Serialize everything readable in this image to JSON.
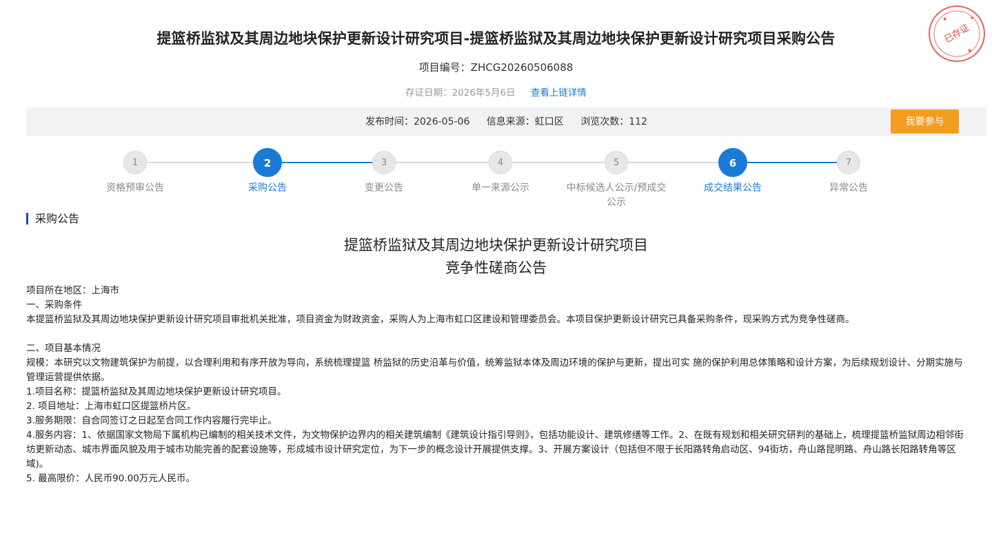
{
  "header": {
    "title": "提篮桥监狱及其周边地块保护更新设计研究项目-提篮桥监狱及其周边地块保护更新设计研究项目采购公告",
    "project_number": "项目编号：ZHCG20260506088",
    "evidence_date": "存证日期：2026年5月6日",
    "evidence_link": "查看上链详情",
    "seal_text": "已存证"
  },
  "info_bar": {
    "publish_time": "发布时间：2026-05-06",
    "source": "信息来源：虹口区",
    "views": "浏览次数：112",
    "join_button": "我要参与"
  },
  "steps": [
    {
      "num": "1",
      "label": "资格预审公告",
      "active": false
    },
    {
      "num": "2",
      "label": "采购公告",
      "active": true
    },
    {
      "num": "3",
      "label": "变更公告",
      "active": false
    },
    {
      "num": "4",
      "label": "单一来源公示",
      "active": false
    },
    {
      "num": "5",
      "label": "中标候选人公示/预成交",
      "label_line2": "公示",
      "active": false
    },
    {
      "num": "6",
      "label": "成交结果公告",
      "active": true
    },
    {
      "num": "7",
      "label": "异常公告",
      "active": false
    }
  ],
  "colors": {
    "accent": "#1a7bd6",
    "join_button": "#f39c1f",
    "seal": "#e0453f"
  },
  "section": {
    "title": "采购公告"
  },
  "document": {
    "title_line1": "提篮桥监狱及其周边地块保护更新设计研究项目",
    "title_line2": "竞争性磋商公告",
    "paragraphs": [
      "项目所在地区：上海市",
      "一、采购条件",
      "本提篮桥监狱及其周边地块保护更新设计研究项目审批机关批准，项目资金为财政资金，采购人为上海市虹口区建设和管理委员会。本项目保护更新设计研究已具备采购条件，现采购方式为竞争性磋商。",
      "",
      "二、项目基本情况",
      "规模：本研究以文物建筑保护为前提，以合理利用和有序开放为导向，系统梳理提篮 桥监狱的历史沿革与价值，统筹监狱本体及周边环境的保护与更新，提出可实 施的保护利用总体策略和设计方案，为后续规划设计、分期实施与管理运营提供依据。",
      "1.项目名称：提篮桥监狱及其周边地块保护更新设计研究项目。",
      "2. 项目地址：上海市虹口区提篮桥片区。",
      "3.服务期限：自合同签订之日起至合同工作内容履行完毕止。",
      "4.服务内容：1、依据国家文物局下属机构已编制的相关技术文件，为文物保护边界内的相关建筑编制《建筑设计指引导则》，包括功能设计、建筑修缮等工作。2、在既有规划和相关研究研判的基础上，梳理提篮桥监狱周边相邻街坊更新动态、城市界面风貌及用于城市功能完善的配套设施等，形成城市设计研究定位，为下一步的概念设计开展提供支撑。3、开展方案设计（包括但不限于长阳路转角启动区、94街坊，舟山路昆明路、舟山路长阳路转角等区域)。",
      "5. 最高限价：人民币90.00万元人民币。"
    ]
  }
}
